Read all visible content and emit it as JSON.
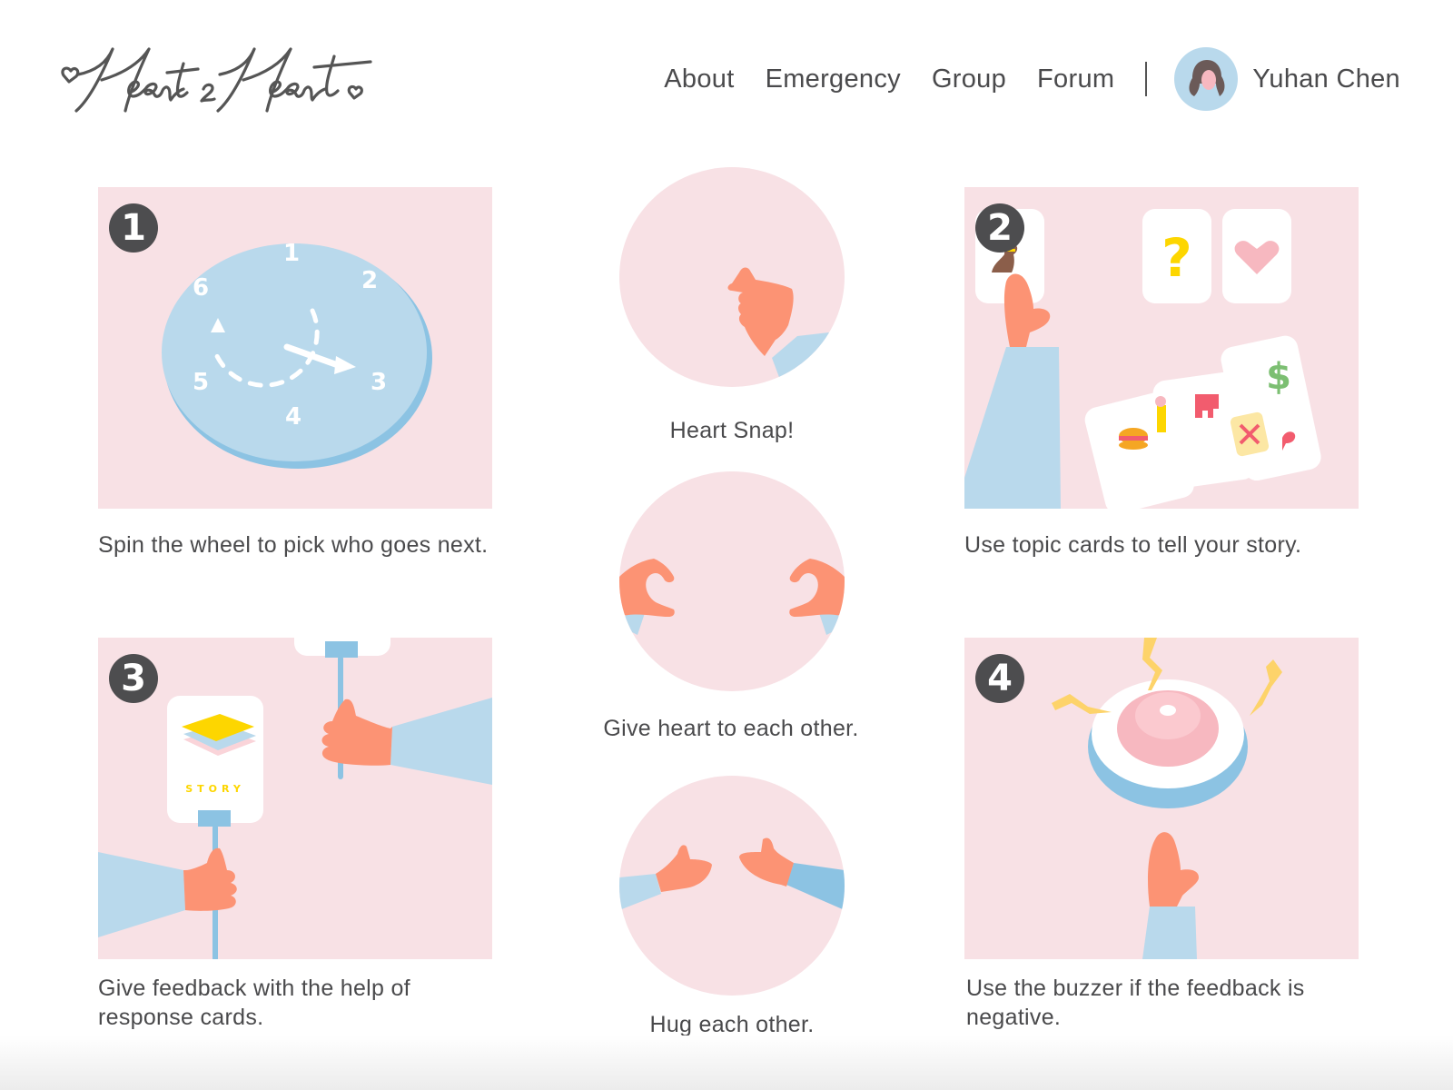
{
  "brand": {
    "logo_text": "Heart2Heart"
  },
  "nav": {
    "items": [
      {
        "label": "About"
      },
      {
        "label": "Emergency"
      },
      {
        "label": "Group"
      },
      {
        "label": "Forum"
      }
    ],
    "user": {
      "name": "Yuhan Chen",
      "avatar_icon": "woman-avatar-icon"
    }
  },
  "steps": [
    {
      "number": "1",
      "caption": "Spin the wheel to pick who goes next.",
      "illustration": "spin-wheel",
      "wheel_numbers": [
        "1",
        "2",
        "3",
        "4",
        "5",
        "6"
      ]
    },
    {
      "number": "2",
      "caption": "Use topic cards to tell your story.",
      "illustration": "topic-cards"
    },
    {
      "number": "3",
      "caption": "Give feedback with the help of response cards.",
      "illustration": "response-cards",
      "card_label": "STORY"
    },
    {
      "number": "4",
      "caption": "Use the buzzer if the feedback is negative.",
      "illustration": "buzzer"
    }
  ],
  "gestures": [
    {
      "caption": "Heart Snap!",
      "illustration": "finger-heart"
    },
    {
      "caption": "Give heart to each other.",
      "illustration": "hand-heart"
    },
    {
      "caption": "Hug each other.",
      "illustration": "hug"
    }
  ],
  "colors": {
    "panel_bg": "#f8e1e5",
    "skin": "#fc9374",
    "sleeve": "#b9d9ec",
    "sleeve_dark": "#8cc3e3",
    "badge": "#4d4d4f",
    "text": "#4a4a4c",
    "yellow": "#fdd600",
    "pink": "#f7b8c0"
  }
}
